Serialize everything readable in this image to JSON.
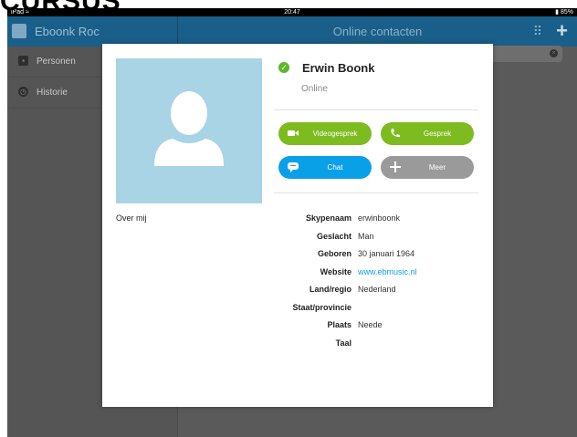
{
  "overlay": {
    "title": "CURSUS"
  },
  "statusbar": {
    "device": "iPad",
    "wifi_icon": "wifi-icon",
    "time": "20:47",
    "battery": "85%"
  },
  "header": {
    "account_name": "Eboonk Roc",
    "title": "Online contacten",
    "dialpad_icon": "dialpad-icon",
    "add_icon": "plus-icon"
  },
  "sidebar": {
    "items": [
      {
        "label": "Personen",
        "icon": "contacts-icon"
      },
      {
        "label": "Historie",
        "icon": "clock-icon"
      }
    ]
  },
  "profile": {
    "name": "Erwin Boonk",
    "status": "Online",
    "status_color": "#5ab82b",
    "about_label": "Over mij"
  },
  "actions": {
    "video": "Videogesprek",
    "call": "Gesprek",
    "chat": "Chat",
    "more": "Meer"
  },
  "details": [
    {
      "key": "Skypenaam",
      "value": "erwinboonk"
    },
    {
      "key": "Geslacht",
      "value": "Man"
    },
    {
      "key": "Geboren",
      "value": "30 januari 1964"
    },
    {
      "key": "Website",
      "value": "www.ebmusic.nl"
    },
    {
      "key": "Land/regio",
      "value": "Nederland"
    },
    {
      "key": "Staat/provincie",
      "value": ""
    },
    {
      "key": "Plaats",
      "value": "Neede"
    },
    {
      "key": "Taal",
      "value": ""
    }
  ],
  "colors": {
    "header": "#1a5f8a",
    "green": "#7dbb1f",
    "blue": "#0aa0e8",
    "grey": "#9a9a9a",
    "photo_bg": "#a8d4e5"
  }
}
